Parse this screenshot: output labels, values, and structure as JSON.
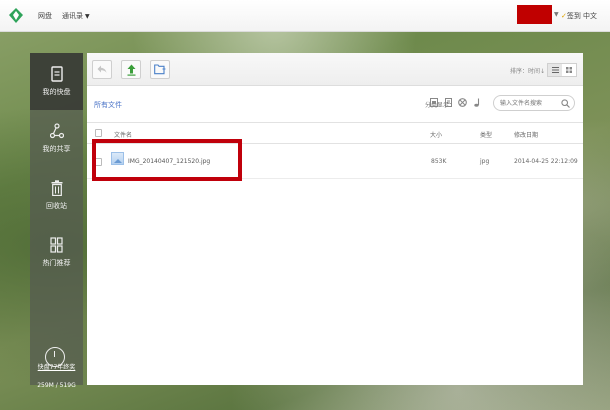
{
  "topbar": {
    "nav": [
      {
        "label": "网盘"
      },
      {
        "label": "通讯录"
      }
    ],
    "checkin_label": "签到",
    "language_label": "中文"
  },
  "sidebar": {
    "items": [
      {
        "label": "我的快盘"
      },
      {
        "label": "我的共享"
      },
      {
        "label": "回收站"
      },
      {
        "label": "热门推荐"
      }
    ],
    "quota_link": "快盘77年终奖",
    "quota_usage": "259M / 519G"
  },
  "toolbar": {
    "sort_label": "排序：时间"
  },
  "content": {
    "breadcrumb": "所有文件",
    "category_label": "分类显示：",
    "search_placeholder": "输入文件名搜索"
  },
  "table": {
    "columns": [
      "文件名",
      "大小",
      "类型",
      "修改日期"
    ],
    "rows": [
      {
        "name": "IMG_20140407_121520.jpg",
        "size": "853K",
        "type": "jpg",
        "modified": "2014-04-25 22:12:09"
      }
    ]
  },
  "colors": {
    "accent": "#4a73c7",
    "highlight": "#c0000b",
    "brand_green": "#2ea35a"
  }
}
